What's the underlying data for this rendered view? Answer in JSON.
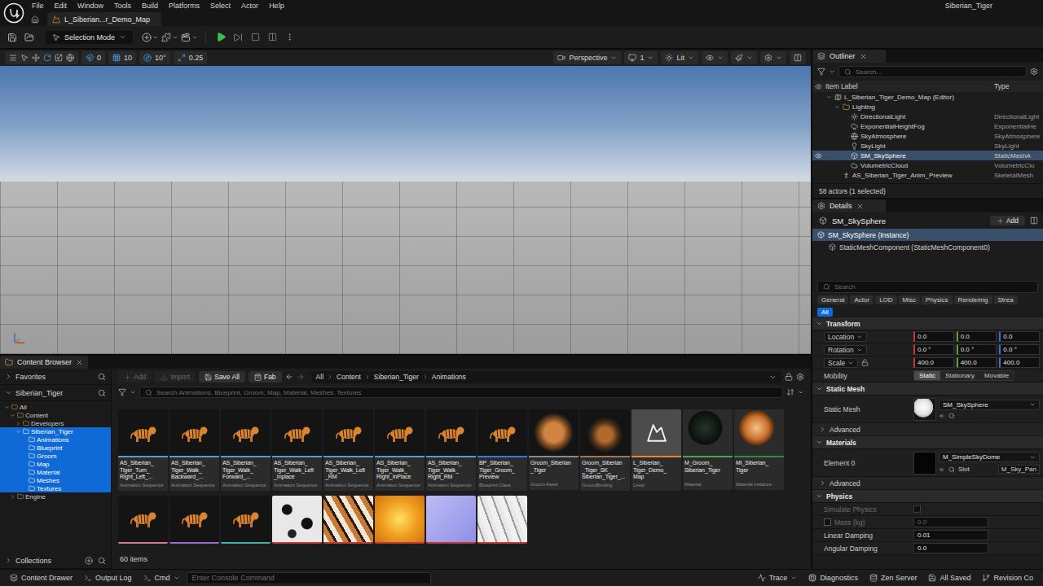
{
  "menu": [
    "File",
    "Edit",
    "Window",
    "Tools",
    "Build",
    "Platforms",
    "Select",
    "Actor",
    "Help"
  ],
  "project": "Siberian_Tiger",
  "document_tab": {
    "label": "L_Siberian...r_Demo_Map",
    "selected": true
  },
  "toolbar": {
    "mode": "Selection Mode"
  },
  "viewport": {
    "snaps": [
      {
        "kind": "surface",
        "value": "0"
      },
      {
        "kind": "grid",
        "value": "10"
      },
      {
        "kind": "angle",
        "value": "10°"
      },
      {
        "kind": "scale",
        "value": "0.25"
      }
    ],
    "view": "Perspective",
    "camera_speed": "1",
    "lighting": "Lit"
  },
  "outliner": {
    "title": "Outliner",
    "search_placeholder": "Search...",
    "columns": [
      "Item Label",
      "Type"
    ],
    "rows": [
      {
        "label": "L_Siberian_Tiger_Demo_Map (Editor)",
        "type": "",
        "depth": 0,
        "kind": "map",
        "expanded": true,
        "selected": false,
        "eye": false
      },
      {
        "label": "Lighting",
        "type": "",
        "depth": 1,
        "kind": "folder",
        "expanded": true,
        "selected": false,
        "eye": false
      },
      {
        "label": "DirectionalLight",
        "type": "DirectionalLight",
        "depth": 2,
        "kind": "light",
        "selected": false,
        "eye": false
      },
      {
        "label": "ExponentialHeightFog",
        "type": "ExponentialHe",
        "depth": 2,
        "kind": "fog",
        "selected": false,
        "eye": false
      },
      {
        "label": "SkyAtmosphere",
        "type": "SkyAtmosphere",
        "depth": 2,
        "kind": "atmosphere",
        "selected": false,
        "eye": false
      },
      {
        "label": "SkyLight",
        "type": "SkyLight",
        "depth": 2,
        "kind": "skylight",
        "selected": false,
        "eye": false
      },
      {
        "label": "SM_SkySphere",
        "type": "StaticMeshA",
        "depth": 2,
        "kind": "mesh",
        "selected": true,
        "eye": true
      },
      {
        "label": "VolumetricCloud",
        "type": "VolumetricClo",
        "depth": 2,
        "kind": "cloud",
        "selected": false,
        "eye": false
      },
      {
        "label": "AS_Siberian_Tiger_Anim_Preview",
        "type": "SkeletalMesh",
        "depth": 1,
        "kind": "skeletal",
        "selected": false,
        "eye": false
      }
    ],
    "footer": "58 actors (1 selected)"
  },
  "details": {
    "title": "Details",
    "actor": "SM_SkySphere",
    "add": "Add",
    "components": [
      {
        "label": "SM_SkySphere (Instance)",
        "depth": 0,
        "selected": true
      },
      {
        "label": "StaticMeshComponent (StaticMeshComponent0)",
        "depth": 1,
        "selected": false
      }
    ],
    "search_placeholder": "Search",
    "filters": [
      {
        "label": "General",
        "selected": false
      },
      {
        "label": "Actor",
        "selected": false
      },
      {
        "label": "LOD",
        "selected": false
      },
      {
        "label": "Misc",
        "selected": false
      },
      {
        "label": "Physics",
        "selected": false
      },
      {
        "label": "Rendering",
        "selected": false
      },
      {
        "label": "Strea",
        "selected": false
      }
    ],
    "all_filter": {
      "label": "All",
      "selected": true
    },
    "sections": [
      {
        "title": "Transform",
        "expanded": true,
        "rows": [
          {
            "kind": "vector",
            "label": "Location",
            "values": [
              "0.0",
              "0.0",
              "0.0"
            ]
          },
          {
            "kind": "vector",
            "label": "Rotation",
            "values": [
              "0.0 °",
              "0.0 °",
              "0.0 °"
            ]
          },
          {
            "kind": "vector",
            "label": "Scale",
            "values": [
              "400.0",
              "400.0",
              "400.0"
            ],
            "locked": false
          },
          {
            "kind": "segmented",
            "label": "Mobility",
            "options": [
              {
                "label": "Static",
                "selected": true
              },
              {
                "label": "Stationary",
                "selected": false
              },
              {
                "label": "Movable",
                "selected": false
              }
            ]
          }
        ]
      },
      {
        "title": "Static Mesh",
        "expanded": true,
        "rows": [
          {
            "kind": "mesh",
            "label": "Static Mesh",
            "value": "SM_SkySphere"
          },
          {
            "kind": "advanced",
            "label": "Advanced",
            "expanded": false
          }
        ]
      },
      {
        "title": "Materials",
        "expanded": true,
        "rows": [
          {
            "kind": "material",
            "label": "Element 0",
            "value": "M_SimpleSkyDome",
            "slot_label": "Slot",
            "slot_value": "M_Sky_Pan"
          },
          {
            "kind": "advanced",
            "label": "Advanced",
            "expanded": false
          }
        ]
      },
      {
        "title": "Physics",
        "expanded": true,
        "rows": [
          {
            "kind": "checkbox",
            "label": "Simulate Physics",
            "checked": false,
            "disabled": true
          },
          {
            "kind": "number",
            "label": "Mass (kg)",
            "value": "0.0",
            "disabled": true,
            "override_checked": false
          },
          {
            "kind": "number",
            "label": "Linear Damping",
            "value": "0.01",
            "disabled": false
          },
          {
            "kind": "number",
            "label": "Angular Damping",
            "value": "0.0",
            "disabled": false
          }
        ]
      }
    ]
  },
  "content_browser": {
    "tab": "Content Browser",
    "favorites": "Favorites",
    "root": "Siberian_Tiger",
    "tree": [
      {
        "label": "All",
        "depth": 0,
        "expanded": true,
        "selected": false
      },
      {
        "label": "Content",
        "depth": 1,
        "expanded": true,
        "selected": false
      },
      {
        "label": "Developers",
        "depth": 2,
        "expanded": false,
        "selected": false
      },
      {
        "label": "Siberian_Tiger",
        "depth": 2,
        "expanded": true,
        "selected": true
      },
      {
        "label": "Animations",
        "depth": 3,
        "selected": true
      },
      {
        "label": "Blueprint",
        "depth": 3,
        "selected": true
      },
      {
        "label": "Groom",
        "depth": 3,
        "selected": true
      },
      {
        "label": "Map",
        "depth": 3,
        "selected": true
      },
      {
        "label": "Material",
        "depth": 3,
        "selected": true
      },
      {
        "label": "Meshes",
        "depth": 3,
        "selected": true
      },
      {
        "label": "Textures",
        "depth": 3,
        "selected": true
      },
      {
        "label": "Engine",
        "depth": 1,
        "expanded": false,
        "selected": false
      }
    ],
    "collections": "Collections",
    "buttons": [
      {
        "label": "Add",
        "kind": "add",
        "disabled": true
      },
      {
        "label": "Import",
        "kind": "import",
        "disabled": true
      },
      {
        "label": "Save All",
        "kind": "save",
        "disabled": false
      },
      {
        "label": "Fab",
        "kind": "fab",
        "disabled": false
      }
    ],
    "path": [
      "All",
      "Content",
      "Siberian_Tiger",
      "Animations"
    ],
    "search_placeholder": "Search Animations, Blueprint, Groom, Map, Material, Meshes, Textures",
    "assets": [
      {
        "name_lines": [
          "AS_Siberian_",
          "Tiger_Turn_",
          "Right_Left_..."
        ],
        "type": "Animation Sequence",
        "kind": "anim",
        "color": "#4f9fd4"
      },
      {
        "name_lines": [
          "AS_Siberian_",
          "Tiger_Walk_",
          "Backward_..."
        ],
        "type": "Animation Sequence",
        "kind": "anim",
        "color": "#4f9fd4"
      },
      {
        "name_lines": [
          "AS_Siberian_",
          "Tiger_Walk_",
          "Forward_..."
        ],
        "type": "Animation Sequence",
        "kind": "anim",
        "color": "#4f9fd4"
      },
      {
        "name_lines": [
          "AS_Siberian_",
          "Tiger_Walk_Left",
          "_Inplace"
        ],
        "type": "Animation Sequence",
        "kind": "anim",
        "color": "#4f9fd4"
      },
      {
        "name_lines": [
          "AS_Siberian_",
          "Tiger_Walk_Left",
          "_RM"
        ],
        "type": "Animation Sequence",
        "kind": "anim",
        "color": "#4f9fd4"
      },
      {
        "name_lines": [
          "AS_Siberian_",
          "Tiger_Walk_",
          "Right_InPlace"
        ],
        "type": "Animation Sequence",
        "kind": "anim",
        "color": "#4f9fd4"
      },
      {
        "name_lines": [
          "AS_Siberian_",
          "Tiger_Walk_",
          "Right_RM"
        ],
        "type": "Animation Sequence",
        "kind": "anim",
        "color": "#4f9fd4"
      },
      {
        "name_lines": [
          "BP_Siberian_",
          "Tiger_Groom_",
          "Preview"
        ],
        "type": "Blueprint Class",
        "kind": "blueprint",
        "color": "#3f74d8"
      },
      {
        "name_lines": [
          "Groom_Siberian",
          "_Tiger"
        ],
        "type": "Groom Asset",
        "kind": "groom",
        "color": "#8a8a8a"
      },
      {
        "name_lines": [
          "Groom_Siberian",
          "_Tiger_SK_",
          "Siberian_Tiger_..."
        ],
        "type": "GroomBinding",
        "kind": "binding",
        "color": "#9a7a5a"
      },
      {
        "name_lines": [
          "L_Siberian_",
          "Tiger_Demo_",
          "Map"
        ],
        "type": "Level",
        "kind": "level",
        "color": "#e08a2c"
      },
      {
        "name_lines": [
          "M_Groom_",
          "Siberian_Tiger"
        ],
        "type": "Material",
        "kind": "material",
        "color": "#4aa64a"
      },
      {
        "name_lines": [
          "MI_Siberian_",
          "Tiger"
        ],
        "type": "Material Instance",
        "kind": "instance",
        "color": "#2f8a3a"
      },
      {
        "kind": "mesh",
        "color": "#d27aa8"
      },
      {
        "kind": "skeleton",
        "color": "#9a6ad0"
      },
      {
        "kind": "physics",
        "color": "#3fb3a6"
      },
      {
        "kind": "mask",
        "color": "#c23a3a"
      },
      {
        "kind": "albedo",
        "color": "#c23a3a"
      },
      {
        "kind": "roughness",
        "color": "#c23a3a"
      },
      {
        "kind": "normal",
        "color": "#c23a3a"
      },
      {
        "kind": "gray",
        "color": "#c23a3a"
      }
    ],
    "count": "60 items"
  },
  "status_bar": {
    "left": [
      {
        "label": "Content Drawer",
        "kind": "drawer"
      },
      {
        "label": "Output Log",
        "kind": "log"
      },
      {
        "label": "Cmd",
        "kind": "cmd"
      }
    ],
    "console_placeholder": "Enter Console Command",
    "right": [
      {
        "label": "Trace",
        "kind": "trace"
      },
      {
        "label": "Diagnostics",
        "kind": "diagnostics"
      },
      {
        "label": "Zen Server",
        "kind": "server"
      },
      {
        "label": "All Saved",
        "kind": "saved"
      },
      {
        "label": "Revision Co",
        "kind": "revision"
      }
    ]
  }
}
